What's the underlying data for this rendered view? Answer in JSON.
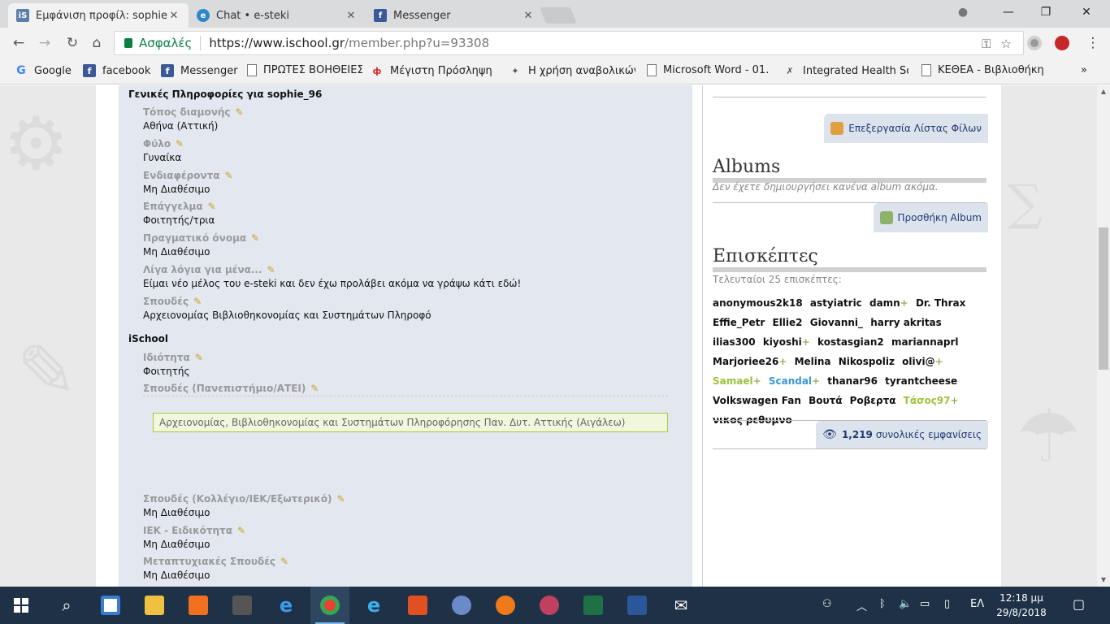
{
  "browser": {
    "tabs": [
      {
        "title": "Εμφάνιση προφίλ: sophie",
        "favicon": "iS",
        "color": "#5b7fa8"
      },
      {
        "title": "Chat • e-steki",
        "favicon": "e",
        "color": "#2f86c9"
      },
      {
        "title": "Messenger",
        "favicon": "f",
        "color": "#3b5998"
      }
    ],
    "secure_label": "Ασφαλές",
    "url_host": "https://www.ischool.gr",
    "url_path": "/member.php?u=93308",
    "bookmarks": [
      {
        "label": "Google",
        "icon": "google-icon"
      },
      {
        "label": "facebook",
        "icon": "facebook-icon"
      },
      {
        "label": "Messenger",
        "icon": "facebook-icon"
      },
      {
        "label": "ΠΡΩΤΕΣ ΒΟΗΘΕΙΕΣ",
        "icon": "document-icon"
      },
      {
        "label": "Μέγιστη Πρόσληψη (",
        "icon": "pdf-icon"
      },
      {
        "label": "Η χρήση αναβολικών",
        "icon": "figure-icon"
      },
      {
        "label": "Microsoft Word - 01.",
        "icon": "document-icon"
      },
      {
        "label": "Integrated Health Sol",
        "icon": "tool-icon"
      },
      {
        "label": "ΚΕΘΕΑ - Βιβλιοθήκη",
        "icon": "document-icon"
      }
    ],
    "more": "»"
  },
  "profile": {
    "general_title": "Γενικές Πληροφορίες για sophie_96",
    "fields": [
      {
        "label": "Τόπος διαμονής",
        "value": "Αθήνα (Αττική)"
      },
      {
        "label": "Φύλο",
        "value": "Γυναίκα"
      },
      {
        "label": "Ενδιαφέροντα",
        "value": "Μη Διαθέσιμο"
      },
      {
        "label": "Επάγγελμα",
        "value": "Φοιτητής/τρια"
      },
      {
        "label": "Πραγματικό όνομα",
        "value": "Μη Διαθέσιμο"
      },
      {
        "label": "Λίγα λόγια για μένα...",
        "value": "Είμαι νέο μέλος του e-steki και δεν έχω προλάβει ακόμα να γράψω κάτι εδώ!"
      },
      {
        "label": "Σπουδές",
        "value": "Αρχειονομίας Βιβλιοθηκονομίας και Συστημάτων Πληροφό"
      }
    ],
    "ischool_title": "iSchool",
    "ischool_fields": [
      {
        "label": "Ιδιότητα",
        "value": "Φοιτητής"
      },
      {
        "label": "Σπουδές (Πανεπιστήμιο/ΑΤΕΙ)",
        "value": ""
      },
      {
        "label": "Σπουδές (Κολλέγιο/ΙΕΚ/Εξωτερικό)",
        "value": "Μη Διαθέσιμο"
      },
      {
        "label": "ΙΕΚ - Ειδικότητα",
        "value": "Μη Διαθέσιμο"
      },
      {
        "label": "Μεταπτυχιακές Σπουδές",
        "value": "Μη Διαθέσιμο"
      }
    ],
    "university_box": "Αρχειονομίας, Βιβλιοθηκονομίας και Συστημάτων Πληροφόρησης Παν. Δυτ. Αττικής (Αιγάλεω)"
  },
  "sidebar": {
    "edit_friends": "Επεξεργασία Λίστας Φίλων",
    "albums_title": "Albums",
    "albums_note": "Δεν έχετε δημιουργήσει κανένα album ακόμα.",
    "add_album": "Προσθήκη Album",
    "visitors_title": "Επισκέπτες",
    "visitors_sub": "Τελευταίοι 25 επισκέπτες:",
    "visitors": [
      {
        "name": "anonymous2k18",
        "plus": false,
        "style": ""
      },
      {
        "name": "astyiatric",
        "plus": false,
        "style": ""
      },
      {
        "name": "damn",
        "plus": true,
        "style": ""
      },
      {
        "name": "Dr. Thrax",
        "plus": false,
        "style": ""
      },
      {
        "name": "Effie_Petr",
        "plus": false,
        "style": ""
      },
      {
        "name": "Ellie2",
        "plus": false,
        "style": ""
      },
      {
        "name": "Giovanni_",
        "plus": false,
        "style": ""
      },
      {
        "name": "harry akritas",
        "plus": false,
        "style": ""
      },
      {
        "name": "ilias300",
        "plus": false,
        "style": ""
      },
      {
        "name": "kiyoshi",
        "plus": true,
        "style": ""
      },
      {
        "name": "kostasgian2",
        "plus": false,
        "style": ""
      },
      {
        "name": "mariannaprl",
        "plus": false,
        "style": ""
      },
      {
        "name": "Marjoriee26",
        "plus": true,
        "style": ""
      },
      {
        "name": "Melina",
        "plus": false,
        "style": ""
      },
      {
        "name": "Nikospoliz",
        "plus": false,
        "style": ""
      },
      {
        "name": "olivi@",
        "plus": true,
        "style": ""
      },
      {
        "name": "Samael",
        "plus": true,
        "style": "green"
      },
      {
        "name": "Scandal",
        "plus": true,
        "style": "blue"
      },
      {
        "name": "thanar96",
        "plus": false,
        "style": ""
      },
      {
        "name": "tyrantcheese",
        "plus": false,
        "style": ""
      },
      {
        "name": "Volkswagen Fan",
        "plus": false,
        "style": ""
      },
      {
        "name": "Βουτά",
        "plus": false,
        "style": ""
      },
      {
        "name": "Ροβερτα",
        "plus": false,
        "style": ""
      },
      {
        "name": "Τάσος97",
        "plus": true,
        "style": "green"
      },
      {
        "name": "νικος ρεθυμνο",
        "plus": false,
        "style": ""
      }
    ],
    "views_count": "1,219",
    "views_label": "συνολικές εμφανίσεις"
  },
  "taskbar": {
    "lang": "ΕΛ",
    "time": "12:18 μμ",
    "date": "29/8/2018"
  }
}
